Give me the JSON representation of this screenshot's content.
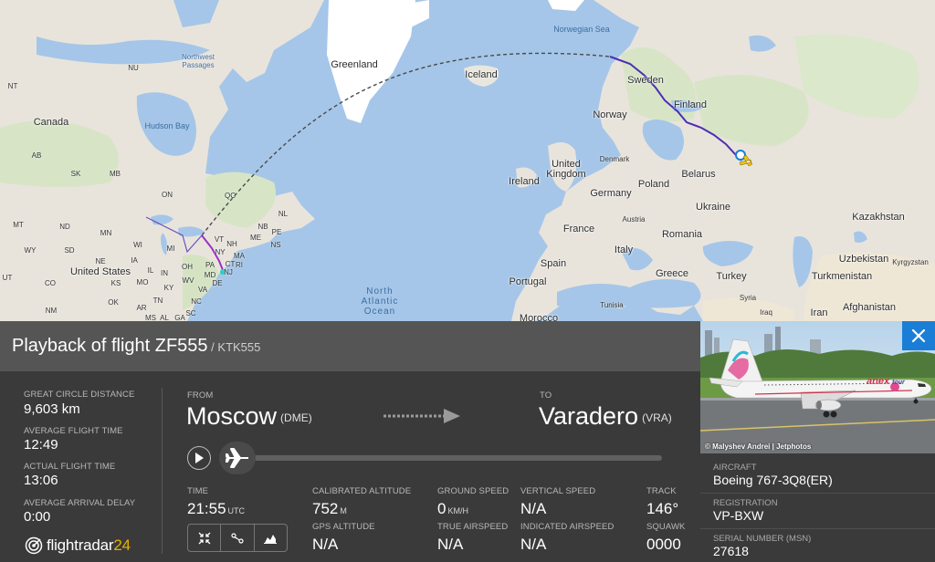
{
  "map": {
    "labels": {
      "northwest_passages": "Northwest\nPassages",
      "nt": "NT",
      "nu": "NU",
      "greenland": "Greenland",
      "norwegian_sea": "Norwegian Sea",
      "iceland": "Iceland",
      "canada": "Canada",
      "hudson_bay": "Hudson Bay",
      "ab": "AB",
      "sk": "SK",
      "mb": "MB",
      "on": "ON",
      "qc": "QC",
      "nl": "NL",
      "nb": "NB",
      "pe": "PE",
      "ns": "NS",
      "mt": "MT",
      "nd": "ND",
      "mn": "MN",
      "wi": "WI",
      "mi": "MI",
      "wy": "WY",
      "sd": "SD",
      "ia": "IA",
      "ne": "NE",
      "il": "IL",
      "oh": "OH",
      "pa": "PA",
      "ny": "NY",
      "vt": "VT",
      "nh": "NH",
      "ma": "MA",
      "ct": "CT",
      "ri": "RI",
      "nj": "NJ",
      "md": "MD",
      "de": "DE",
      "me": "ME",
      "ut": "UT",
      "co": "CO",
      "ks": "KS",
      "mo": "MO",
      "ky": "KY",
      "wv": "WV",
      "va": "VA",
      "in": "IN",
      "tn": "TN",
      "nc": "NC",
      "ok": "OK",
      "ar": "AR",
      "sc": "SC",
      "nm": "NM",
      "ms": "MS",
      "al": "AL",
      "ga": "GA",
      "united_states": "United States",
      "north_atlantic_ocean": "North\nAtlantic\nOcean",
      "sweden": "Sweden",
      "finland": "Finland",
      "norway": "Norway",
      "united_kingdom": "United\nKingdom",
      "ireland": "Ireland",
      "denmark": "Denmark",
      "belarus": "Belarus",
      "germany": "Germany",
      "poland": "Poland",
      "france": "France",
      "austria": "Austria",
      "ukraine": "Ukraine",
      "kazakhstan": "Kazakhstan",
      "romania": "Romania",
      "italy": "Italy",
      "spain": "Spain",
      "portugal": "Portugal",
      "greece": "Greece",
      "turkey": "Turkey",
      "uzbekistan": "Uzbekistan",
      "kyrgyzstan": "Kyrgyzstan",
      "turkmenistan": "Turkmenistan",
      "syria": "Syria",
      "iraq": "Iraq",
      "iran": "Iran",
      "afghanistan": "Afghanistan",
      "tunisia": "Tunisia",
      "morocco": "Morocco"
    }
  },
  "flight": {
    "title_prefix": "Playback of flight ",
    "flight_number": "ZF555",
    "callsign": " / KTK555"
  },
  "stats": {
    "great_circle_distance_label": "GREAT CIRCLE DISTANCE",
    "great_circle_distance_value": "9,603 km",
    "average_flight_time_label": "AVERAGE FLIGHT TIME",
    "average_flight_time_value": "12:49",
    "actual_flight_time_label": "ACTUAL FLIGHT TIME",
    "actual_flight_time_value": "13:06",
    "average_arrival_delay_label": "AVERAGE ARRIVAL DELAY",
    "average_arrival_delay_value": "0:00"
  },
  "route": {
    "from_label": "FROM",
    "from_city": "Moscow",
    "from_code": "(DME)",
    "to_label": "TO",
    "to_city": "Varadero",
    "to_code": "(VRA)"
  },
  "playback": {
    "progress": 0.0
  },
  "telemetry": {
    "time_label": "TIME",
    "time_value": "21:55",
    "time_unit": "UTC",
    "calibrated_altitude_label": "CALIBRATED ALTITUDE",
    "calibrated_altitude_value": "752",
    "calibrated_altitude_unit": "M",
    "gps_altitude_label": "GPS ALTITUDE",
    "gps_altitude_value": "N/A",
    "ground_speed_label": "GROUND SPEED",
    "ground_speed_value": "0",
    "ground_speed_unit": "KM/H",
    "true_airspeed_label": "TRUE AIRSPEED",
    "true_airspeed_value": "N/A",
    "vertical_speed_label": "VERTICAL SPEED",
    "vertical_speed_value": "N/A",
    "indicated_airspeed_label": "INDICATED AIRSPEED",
    "indicated_airspeed_value": "N/A",
    "track_label": "TRACK",
    "track_value": "146°",
    "squawk_label": "SQUAWK",
    "squawk_value": "0000"
  },
  "logo": {
    "text_main": "flightradar",
    "text_accent": "24"
  },
  "aircraft": {
    "photo_credit": "© Malyshev Andrei | Jetphotos",
    "livery_text": "anex",
    "livery_sub": "tour",
    "aircraft_label": "AIRCRAFT",
    "aircraft_value": "Boeing 767-3Q8(ER)",
    "registration_label": "REGISTRATION",
    "registration_value": "VP-BXW",
    "serial_label": "SERIAL NUMBER (MSN)",
    "serial_value": "27618"
  },
  "colors": {
    "accent_blue": "#1a7ed6",
    "track_purple": "#4b2fb4",
    "logo_yellow": "#e8b000"
  }
}
